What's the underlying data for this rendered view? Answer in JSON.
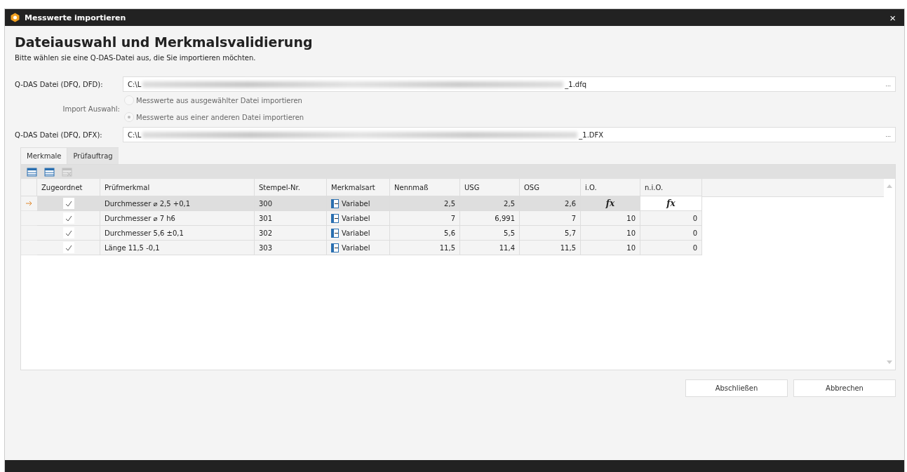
{
  "window": {
    "title": "Messwerte importieren",
    "close": "×"
  },
  "heading": "Dateiauswahl und Merkmalsvalidierung",
  "subtitle": "Bitte wählen sie eine Q-DAS-Datei aus, die Sie importieren möchten.",
  "file_1": {
    "label": "Q-DAS Datei (DFQ, DFD):",
    "path_start": "C:\\L",
    "path_end": "_1.dfq",
    "browse": "..."
  },
  "import_choice": {
    "label": "Import Auswahl:",
    "disabled": true,
    "options": [
      {
        "label": "Messwerte aus ausgewählter Datei importieren",
        "selected": false
      },
      {
        "label": "Messwerte aus einer anderen Datei importieren",
        "selected": true
      }
    ]
  },
  "file_2": {
    "label": "Q-DAS Datei (DFQ, DFX):",
    "path_start": "C:\\L",
    "path_end": "_1.DFX",
    "browse": "..."
  },
  "tabs": [
    {
      "label": "Merkmale",
      "selected": true
    },
    {
      "label": "Prüfauftrag",
      "selected": false
    }
  ],
  "toolbar": [
    {
      "disabled": false
    },
    {
      "disabled": false
    },
    {
      "disabled": true
    }
  ],
  "table": {
    "assigned_column": "Zugeordnet",
    "columns": [
      "Prüfmerkmal",
      "Stempel-Nr.",
      "Merkmalsart",
      "Nennmaß",
      "USG",
      "OSG",
      "i.O.",
      "n.i.O."
    ],
    "rows": [
      {
        "selected": true,
        "assigned": true,
        "formula": true,
        "cells": [
          "Durchmesser ⌀ 2,5 +0,1",
          "300",
          "Variabel",
          "2,5",
          "2,5",
          "2,6",
          "fx",
          "fx"
        ]
      },
      {
        "selected": false,
        "assigned": true,
        "formula": false,
        "cells": [
          "Durchmesser ⌀ 7 h6",
          "301",
          "Variabel",
          "7",
          "6,991",
          "7",
          "10",
          "0"
        ]
      },
      {
        "selected": false,
        "assigned": true,
        "formula": false,
        "cells": [
          "Durchmesser 5,6 ±0,1",
          "302",
          "Variabel",
          "5,6",
          "5,5",
          "5,7",
          "10",
          "0"
        ]
      },
      {
        "selected": false,
        "assigned": true,
        "formula": false,
        "cells": [
          "Länge 11,5 -0,1",
          "303",
          "Variabel",
          "11,5",
          "11,4",
          "11,5",
          "10",
          "0"
        ]
      }
    ]
  },
  "buttons": [
    "Abschließen",
    "Abbrechen"
  ]
}
